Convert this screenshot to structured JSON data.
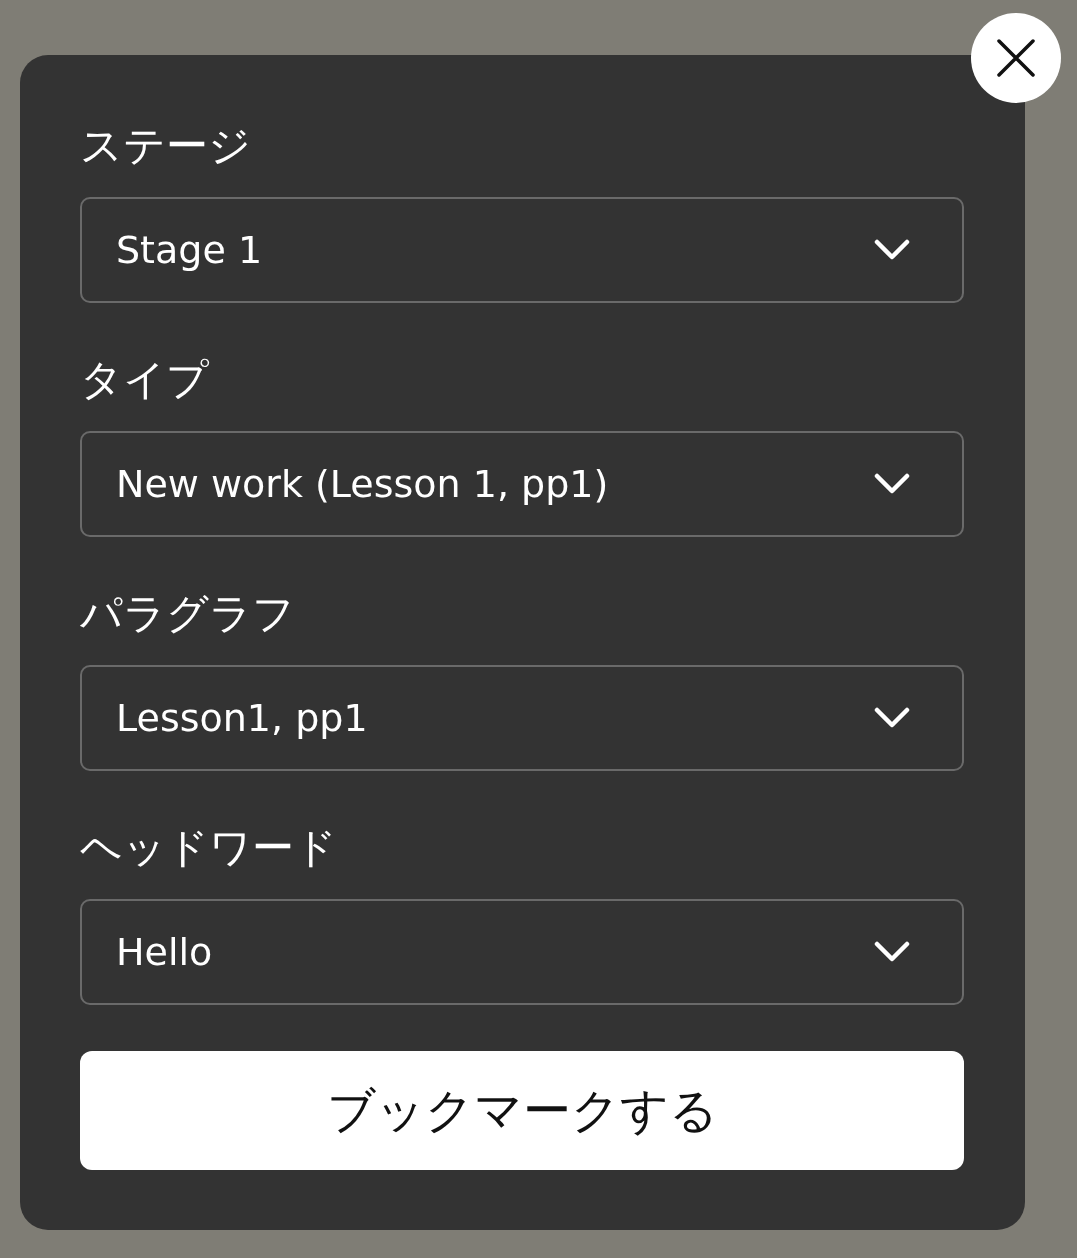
{
  "fields": [
    {
      "label": "ステージ",
      "value": "Stage 1"
    },
    {
      "label": "タイプ",
      "value": "New work (Lesson 1, pp1)"
    },
    {
      "label": "パラグラフ",
      "value": "Lesson1, pp1"
    },
    {
      "label": "ヘッドワード",
      "value": "Hello"
    }
  ],
  "submit": "ブックマークする"
}
